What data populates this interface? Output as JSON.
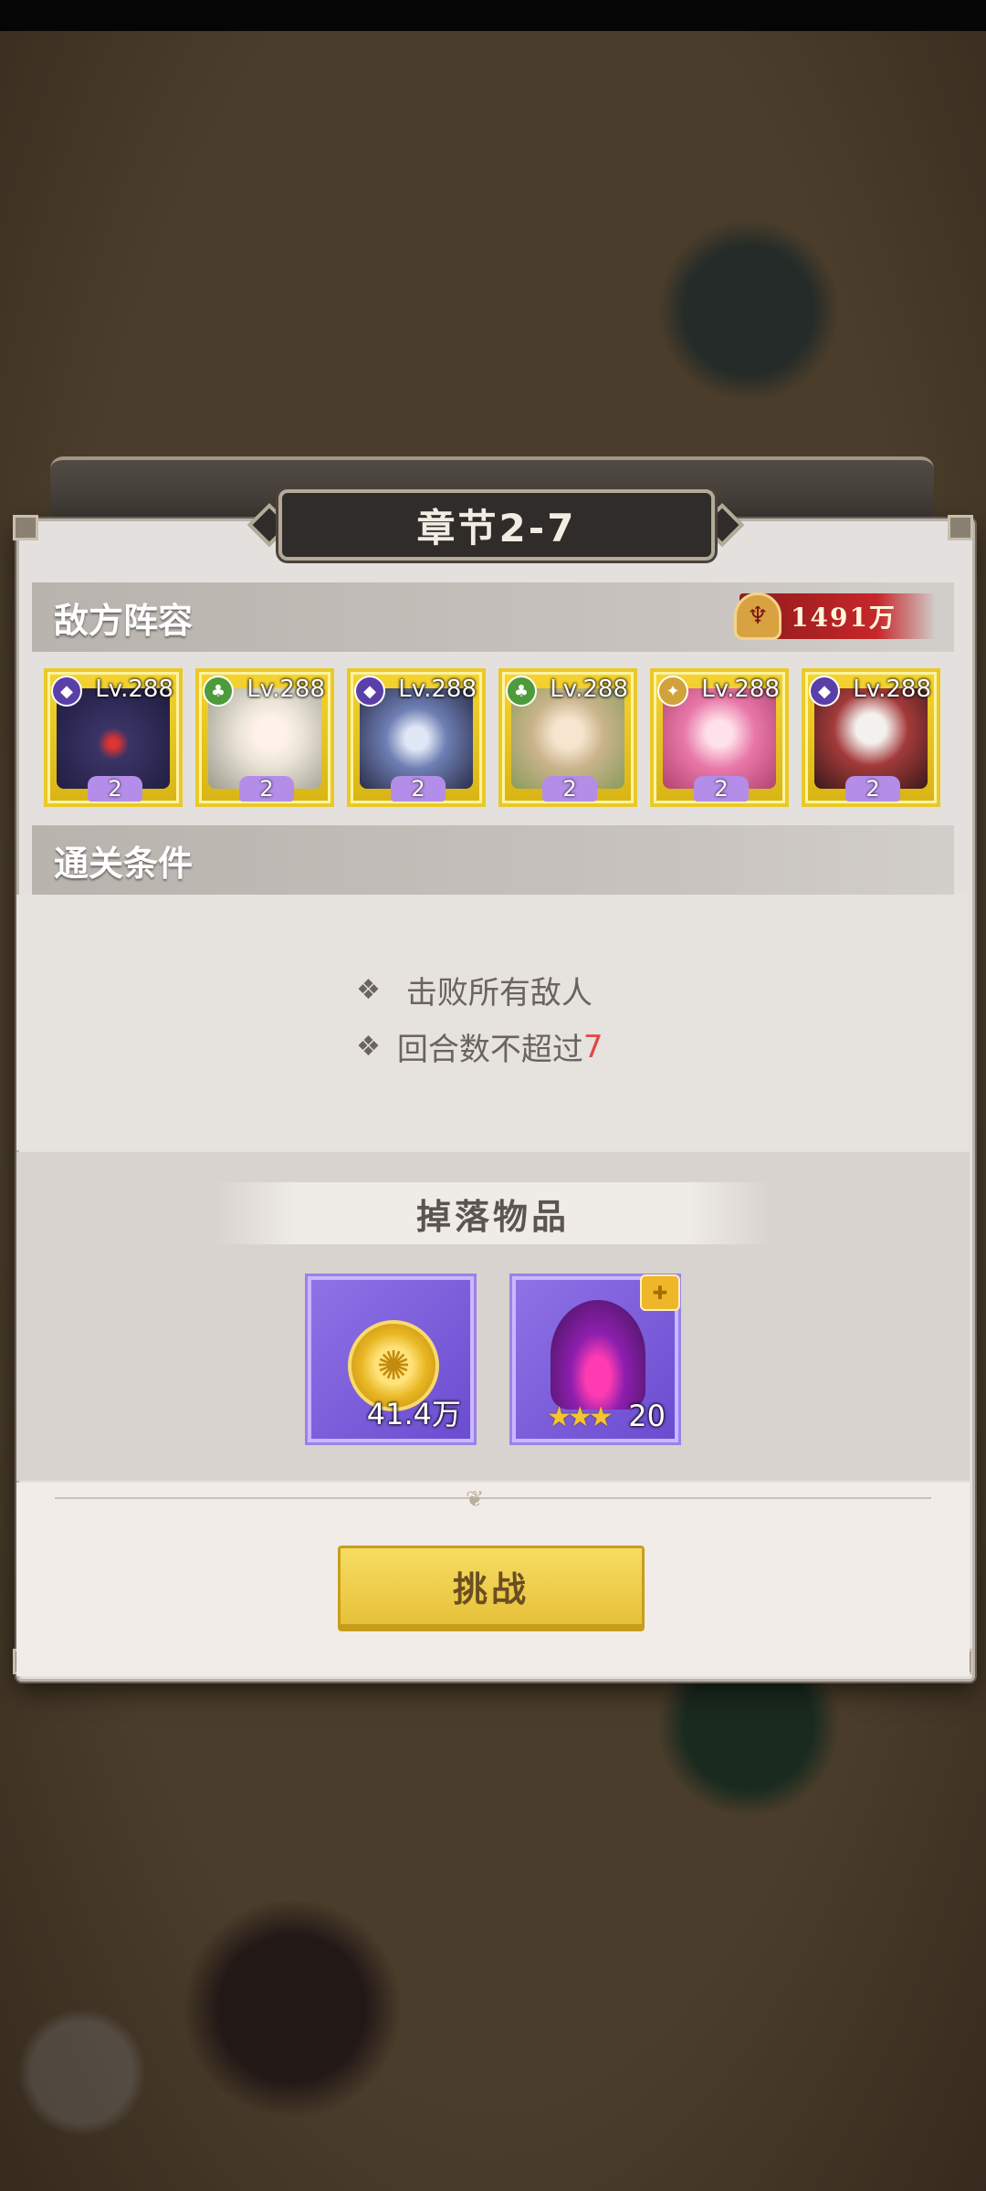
{
  "dialog": {
    "title": "章节2-7",
    "enemy_section_label": "敌方阵容",
    "power_value": "1491万",
    "clear_section_label": "通关条件",
    "conditions": [
      {
        "text": "击败所有敌人",
        "highlight": ""
      },
      {
        "text": "回合数不超过",
        "highlight": "7"
      }
    ],
    "drops_label": "掉落物品",
    "challenge_label": "挑战"
  },
  "enemies": [
    {
      "level": "Lv.288",
      "stars": "2",
      "element_icon": "dark-element-icon",
      "element_color": "#5b3fa8",
      "art_color": "#3a3466"
    },
    {
      "level": "Lv.288",
      "stars": "2",
      "element_icon": "nature-element-icon",
      "element_color": "#4d9b3b",
      "art_color": "#e9e3d6"
    },
    {
      "level": "Lv.288",
      "stars": "2",
      "element_icon": "dark-element-icon",
      "element_color": "#5b3fa8",
      "art_color": "#6e7fb3"
    },
    {
      "level": "Lv.288",
      "stars": "2",
      "element_icon": "nature-element-icon",
      "element_color": "#4d9b3b",
      "art_color": "#c9b48c"
    },
    {
      "level": "Lv.288",
      "stars": "2",
      "element_icon": "light-element-icon",
      "element_color": "#d1a23a",
      "art_color": "#e878a8"
    },
    {
      "level": "Lv.288",
      "stars": "2",
      "element_icon": "dark-element-icon",
      "element_color": "#5b3fa8",
      "art_color": "#a33a3a"
    }
  ],
  "drops": [
    {
      "name": "gold-coin",
      "quantity": "41.4万"
    },
    {
      "name": "helmet-fragment",
      "quantity": "20",
      "stars": "★★★"
    }
  ]
}
